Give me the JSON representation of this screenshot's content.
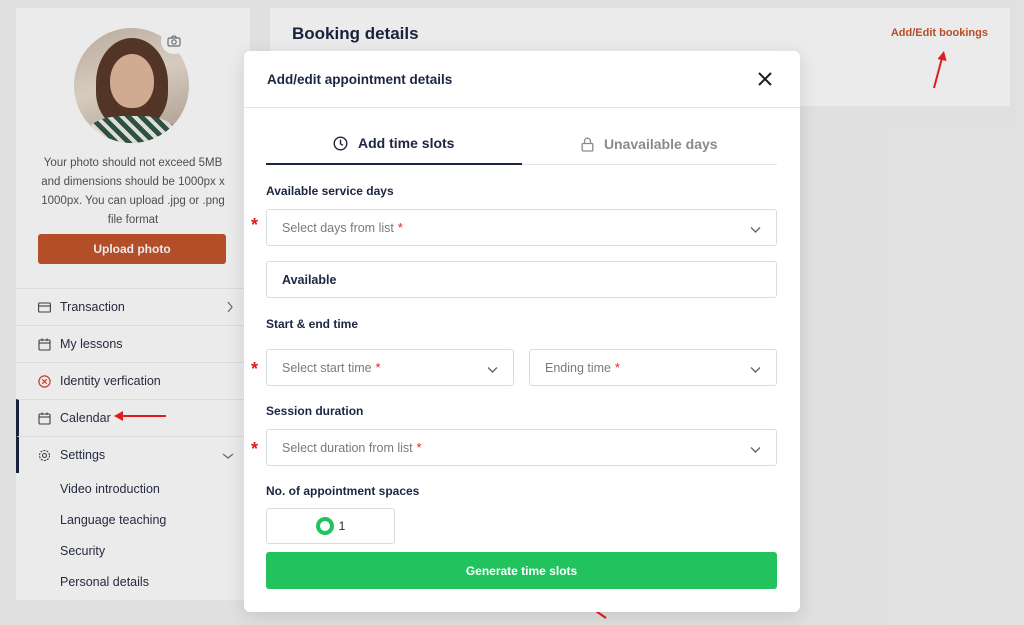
{
  "sidebar": {
    "photo_note": "Your photo should not exceed 5MB and dimensions should be 1000px x 1000px. You can upload .jpg or .png file format",
    "upload_label": "Upload photo",
    "menu": [
      {
        "label": "Transaction"
      },
      {
        "label": "My lessons"
      },
      {
        "label": "Identity verfication"
      },
      {
        "label": "Calendar"
      },
      {
        "label": "Settings"
      }
    ],
    "settings_sub": [
      "Video introduction",
      "Language teaching",
      "Security",
      "Personal details"
    ]
  },
  "booking": {
    "title": "Booking details",
    "link_label": "Add/Edit bookings"
  },
  "modal": {
    "title": "Add/edit appointment details",
    "tabs": [
      {
        "label": "Add time slots",
        "icon": "clock-icon"
      },
      {
        "label": "Unavailable days",
        "icon": "lock-icon"
      }
    ],
    "service_days_label": "Available service days",
    "days_placeholder": "Select days from list",
    "available_value": "Available",
    "time_label": "Start & end time",
    "start_placeholder": "Select start time",
    "end_placeholder": "Ending time",
    "duration_label": "Session duration",
    "duration_placeholder": "Select duration from list",
    "spaces_label": "No. of appointment spaces",
    "spaces_value": "1",
    "generate_label": "Generate time slots",
    "required_mark": "*"
  },
  "colors": {
    "accent_orange": "#c4552c",
    "navy": "#1c2541",
    "green": "#22c35e",
    "required_red": "#e01d1d"
  }
}
